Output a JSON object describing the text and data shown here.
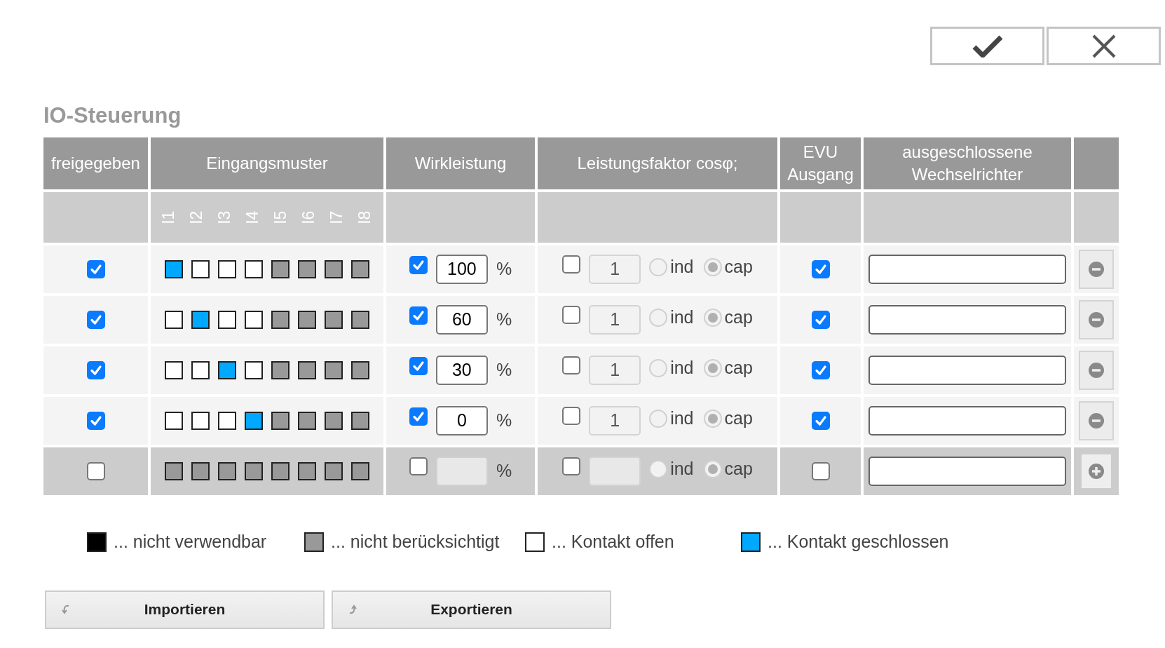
{
  "dialog_buttons": [
    {
      "kind": "confirm"
    },
    {
      "kind": "cancel"
    }
  ],
  "title": "IO-Steuerung",
  "columns": [
    "freigegeben",
    "Eingangsmuster",
    "Wirkleistung",
    "Leistungsfaktor cosφ;",
    "EVU Ausgang",
    "ausgeschlossene Wechselrichter",
    ""
  ],
  "input_labels": [
    "I1",
    "I2",
    "I3",
    "I4",
    "I5",
    "I6",
    "I7",
    "I8"
  ],
  "rows": [
    {
      "kind": "entry",
      "enabled": true,
      "contacts": [
        {
          "color": "#00a8ff"
        },
        {
          "color": "#ffffff"
        },
        {
          "color": "#ffffff"
        },
        {
          "color": "#ffffff"
        },
        {
          "color": "#999999"
        },
        {
          "color": "#999999"
        },
        {
          "color": "#999999"
        },
        {
          "color": "#999999"
        }
      ],
      "power": {
        "checked": true,
        "value": "100",
        "unit": "%",
        "disabled": false
      },
      "cosphi": {
        "checked": false,
        "value": "1",
        "ind": {
          "label": "ind",
          "selected": false
        },
        "cap": {
          "label": "cap",
          "selected": true
        }
      },
      "evu": true
    },
    {
      "kind": "entry",
      "enabled": true,
      "contacts": [
        {
          "color": "#ffffff"
        },
        {
          "color": "#00a8ff"
        },
        {
          "color": "#ffffff"
        },
        {
          "color": "#ffffff"
        },
        {
          "color": "#999999"
        },
        {
          "color": "#999999"
        },
        {
          "color": "#999999"
        },
        {
          "color": "#999999"
        }
      ],
      "power": {
        "checked": true,
        "value": "60",
        "unit": "%",
        "disabled": false
      },
      "cosphi": {
        "checked": false,
        "value": "1",
        "ind": {
          "label": "ind",
          "selected": false
        },
        "cap": {
          "label": "cap",
          "selected": true
        }
      },
      "evu": true
    },
    {
      "kind": "entry",
      "enabled": true,
      "contacts": [
        {
          "color": "#ffffff"
        },
        {
          "color": "#ffffff"
        },
        {
          "color": "#00a8ff"
        },
        {
          "color": "#ffffff"
        },
        {
          "color": "#999999"
        },
        {
          "color": "#999999"
        },
        {
          "color": "#999999"
        },
        {
          "color": "#999999"
        }
      ],
      "power": {
        "checked": true,
        "value": "30",
        "unit": "%",
        "disabled": false
      },
      "cosphi": {
        "checked": false,
        "value": "1",
        "ind": {
          "label": "ind",
          "selected": false
        },
        "cap": {
          "label": "cap",
          "selected": true
        }
      },
      "evu": true
    },
    {
      "kind": "entry",
      "enabled": true,
      "contacts": [
        {
          "color": "#ffffff"
        },
        {
          "color": "#ffffff"
        },
        {
          "color": "#ffffff"
        },
        {
          "color": "#00a8ff"
        },
        {
          "color": "#999999"
        },
        {
          "color": "#999999"
        },
        {
          "color": "#999999"
        },
        {
          "color": "#999999"
        }
      ],
      "power": {
        "checked": true,
        "value": "0",
        "unit": "%",
        "disabled": false
      },
      "cosphi": {
        "checked": false,
        "value": "1",
        "ind": {
          "label": "ind",
          "selected": false
        },
        "cap": {
          "label": "cap",
          "selected": true
        }
      },
      "evu": true
    },
    {
      "kind": "new",
      "enabled": false,
      "contacts": [
        {
          "color": "#999999"
        },
        {
          "color": "#999999"
        },
        {
          "color": "#999999"
        },
        {
          "color": "#999999"
        },
        {
          "color": "#999999"
        },
        {
          "color": "#999999"
        },
        {
          "color": "#999999"
        },
        {
          "color": "#999999"
        }
      ],
      "power": {
        "checked": false,
        "unit": "%",
        "disabled": true
      },
      "cosphi": {
        "checked": false,
        "ind": {
          "label": "ind",
          "selected": false
        },
        "cap": {
          "label": "cap",
          "selected": true
        }
      },
      "evu": false
    }
  ],
  "legend": [
    {
      "color": "#000000",
      "label": "... nicht verwendbar"
    },
    {
      "color": "#999999",
      "label": "... nicht berücksichtigt"
    },
    {
      "color": "#ffffff",
      "label": "... Kontakt offen"
    },
    {
      "color": "#00a8ff",
      "label": "... Kontakt geschlossen"
    }
  ],
  "actions": [
    {
      "kind": "import",
      "label": "Importieren"
    },
    {
      "kind": "export",
      "label": "Exportieren"
    }
  ]
}
